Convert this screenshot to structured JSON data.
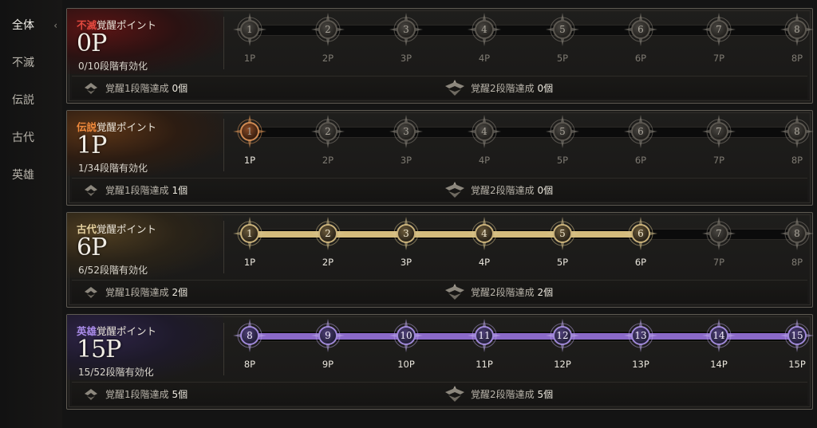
{
  "sidebar": {
    "items": [
      {
        "label": "全体",
        "active": true
      },
      {
        "label": "不滅",
        "active": false
      },
      {
        "label": "伝説",
        "active": false
      },
      {
        "label": "古代",
        "active": false
      },
      {
        "label": "英雄",
        "active": false
      }
    ],
    "chevron": "‹"
  },
  "panels": [
    {
      "rarity": "不滅",
      "rarity_color": "#e0483e",
      "title_suffix": "覚醒ポイント",
      "points": "0P",
      "progress": "0/10段階有効化",
      "filled": 0,
      "fill_color": "none",
      "nodes": [
        "1",
        "2",
        "3",
        "4",
        "5",
        "6",
        "7",
        "8"
      ],
      "labels": [
        "1P",
        "2P",
        "3P",
        "4P",
        "5P",
        "6P",
        "7P",
        "8P"
      ],
      "ach1_text": "覚醒1段階達成",
      "ach1_count": "0個",
      "ach2_text": "覚醒2段階達成",
      "ach2_count": "0個"
    },
    {
      "rarity": "伝説",
      "rarity_color": "#f08a3c",
      "title_suffix": "覚醒ポイント",
      "points": "1P",
      "progress": "1/34段階有効化",
      "filled": 1,
      "fill_color": "none",
      "nodes": [
        "1",
        "2",
        "3",
        "4",
        "5",
        "6",
        "7",
        "8"
      ],
      "labels": [
        "1P",
        "2P",
        "3P",
        "4P",
        "5P",
        "6P",
        "7P",
        "8P"
      ],
      "ach1_text": "覚醒1段階達成",
      "ach1_count": "1個",
      "ach2_text": "覚醒2段階達成",
      "ach2_count": "0個"
    },
    {
      "rarity": "古代",
      "rarity_color": "#e6d2a0",
      "title_suffix": "覚醒ポイント",
      "points": "6P",
      "progress": "6/52段階有効化",
      "filled": 6,
      "fill_color": "#d4bb7c",
      "nodes": [
        "1",
        "2",
        "3",
        "4",
        "5",
        "6",
        "7",
        "8"
      ],
      "labels": [
        "1P",
        "2P",
        "3P",
        "4P",
        "5P",
        "6P",
        "7P",
        "8P"
      ],
      "ach1_text": "覚醒1段階達成",
      "ach1_count": "2個",
      "ach2_text": "覚醒2段階達成",
      "ach2_count": "2個"
    },
    {
      "rarity": "英雄",
      "rarity_color": "#a98be8",
      "title_suffix": "覚醒ポイント",
      "points": "15P",
      "progress": "15/52段階有効化",
      "filled": 8,
      "fill_color": "#8b6ac9",
      "nodes": [
        "8",
        "9",
        "10",
        "11",
        "12",
        "13",
        "14",
        "15"
      ],
      "labels": [
        "8P",
        "9P",
        "10P",
        "11P",
        "12P",
        "13P",
        "14P",
        "15P"
      ],
      "ach1_text": "覚醒1段階達成",
      "ach1_count": "5個",
      "ach2_text": "覚醒2段階達成",
      "ach2_count": "5個"
    }
  ]
}
